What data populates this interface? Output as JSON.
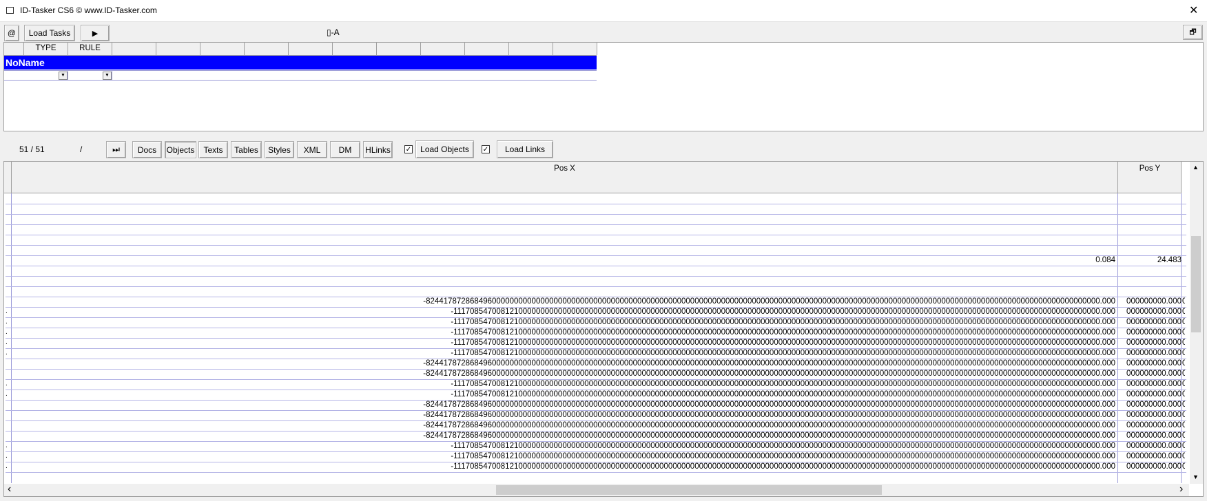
{
  "window": {
    "title": "ID-Tasker CS6  © www.ID-Tasker.com",
    "close_glyph": "✕"
  },
  "toolbar": {
    "at_label": "@",
    "load_tasks_label": "Load Tasks",
    "play_glyph": "▶",
    "mode_label": "▯-A",
    "restore_glyph": "🗗"
  },
  "task_grid": {
    "headers": [
      "TYPE",
      "RULE"
    ],
    "selected_row_label": "NoName"
  },
  "nav": {
    "counter": "51 / 51",
    "slash": "/",
    "ff_glyph": "⏭",
    "tabs": [
      "Docs",
      "Objects",
      "Texts",
      "Tables",
      "Styles",
      "XML",
      "DM",
      "HLinks"
    ],
    "active_tab": "Objects",
    "load_objects_checked": "✓",
    "load_objects_label": "Load Objects",
    "load_links_checked": "✓",
    "load_links_label": "Load Links"
  },
  "data_grid": {
    "columns": [
      "Pos X",
      "Pos Y"
    ],
    "rows": [
      {
        "x": "",
        "y": "",
        "m": ""
      },
      {
        "x": "",
        "y": "",
        "m": ""
      },
      {
        "x": "",
        "y": "",
        "m": ""
      },
      {
        "x": "",
        "y": "",
        "m": ""
      },
      {
        "x": "",
        "y": "",
        "m": ""
      },
      {
        "x": "",
        "y": "",
        "m": ""
      },
      {
        "x": "0.084",
        "y": "24.483",
        "m": ""
      },
      {
        "x": "",
        "y": "",
        "m": ""
      },
      {
        "x": "",
        "y": "",
        "m": ""
      },
      {
        "x": "",
        "y": "",
        "m": ""
      },
      {
        "x": "-824417872868496000000000000000000000000000000000000000000000000000000000000000000000000000000000000000000000000000000000000000000000000000000000000000000.000",
        "y": "000000000.000",
        "m": ""
      },
      {
        "x": "-111708547008121000000000000000000000000000000000000000000000000000000000000000000000000000000000000000000000000000000000000000000000000000000000000.000",
        "y": "000000000.000",
        "m": "."
      },
      {
        "x": "-111708547008121000000000000000000000000000000000000000000000000000000000000000000000000000000000000000000000000000000000000000000000000000000000000.000",
        "y": "000000000.000",
        "m": "."
      },
      {
        "x": "-111708547008121000000000000000000000000000000000000000000000000000000000000000000000000000000000000000000000000000000000000000000000000000000000000.000",
        "y": "000000000.000",
        "m": "."
      },
      {
        "x": "-111708547008121000000000000000000000000000000000000000000000000000000000000000000000000000000000000000000000000000000000000000000000000000000000000.000",
        "y": "000000000.000",
        "m": "."
      },
      {
        "x": "-111708547008121000000000000000000000000000000000000000000000000000000000000000000000000000000000000000000000000000000000000000000000000000000000000.000",
        "y": "000000000.000",
        "m": "."
      },
      {
        "x": "-824417872868496000000000000000000000000000000000000000000000000000000000000000000000000000000000000000000000000000000000000000000000000000000000000000000.000",
        "y": "000000000.000",
        "m": ""
      },
      {
        "x": "-824417872868496000000000000000000000000000000000000000000000000000000000000000000000000000000000000000000000000000000000000000000000000000000000000000000.000",
        "y": "000000000.000",
        "m": ""
      },
      {
        "x": "-111708547008121000000000000000000000000000000000000000000000000000000000000000000000000000000000000000000000000000000000000000000000000000000000000.000",
        "y": "000000000.000",
        "m": "."
      },
      {
        "x": "-111708547008121000000000000000000000000000000000000000000000000000000000000000000000000000000000000000000000000000000000000000000000000000000000000.000",
        "y": "000000000.000",
        "m": "."
      },
      {
        "x": "-824417872868496000000000000000000000000000000000000000000000000000000000000000000000000000000000000000000000000000000000000000000000000000000000000000000.000",
        "y": "000000000.000",
        "m": ""
      },
      {
        "x": "-824417872868496000000000000000000000000000000000000000000000000000000000000000000000000000000000000000000000000000000000000000000000000000000000000000000.000",
        "y": "000000000.000",
        "m": ""
      },
      {
        "x": "-824417872868496000000000000000000000000000000000000000000000000000000000000000000000000000000000000000000000000000000000000000000000000000000000000000000.000",
        "y": "000000000.000",
        "m": ""
      },
      {
        "x": "-824417872868496000000000000000000000000000000000000000000000000000000000000000000000000000000000000000000000000000000000000000000000000000000000000000000.000",
        "y": "000000000.000",
        "m": ""
      },
      {
        "x": "-111708547008121000000000000000000000000000000000000000000000000000000000000000000000000000000000000000000000000000000000000000000000000000000000000.000",
        "y": "000000000.000",
        "m": "."
      },
      {
        "x": "-111708547008121000000000000000000000000000000000000000000000000000000000000000000000000000000000000000000000000000000000000000000000000000000000000.000",
        "y": "000000000.000",
        "m": "."
      },
      {
        "x": "-111708547008121000000000000000000000000000000000000000000000000000000000000000000000000000000000000000000000000000000000000000000000000000000000000.000",
        "y": "000000000.000",
        "m": "."
      }
    ],
    "y2_text": "0"
  },
  "scroll": {
    "up_glyph": "▲",
    "down_glyph": "▼",
    "left_glyph": "‹",
    "right_glyph": "›"
  }
}
